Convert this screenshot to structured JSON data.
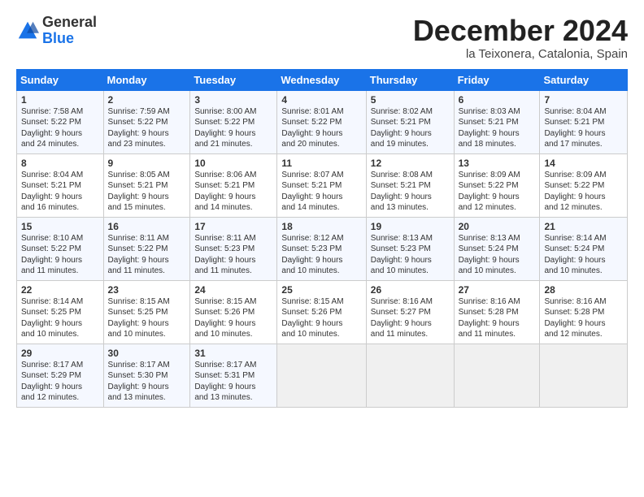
{
  "logo": {
    "general": "General",
    "blue": "Blue"
  },
  "title": "December 2024",
  "subtitle": "la Teixonera, Catalonia, Spain",
  "days_header": [
    "Sunday",
    "Monday",
    "Tuesday",
    "Wednesday",
    "Thursday",
    "Friday",
    "Saturday"
  ],
  "weeks": [
    [
      {
        "day": "1",
        "info": "Sunrise: 7:58 AM\nSunset: 5:22 PM\nDaylight: 9 hours\nand 24 minutes."
      },
      {
        "day": "2",
        "info": "Sunrise: 7:59 AM\nSunset: 5:22 PM\nDaylight: 9 hours\nand 23 minutes."
      },
      {
        "day": "3",
        "info": "Sunrise: 8:00 AM\nSunset: 5:22 PM\nDaylight: 9 hours\nand 21 minutes."
      },
      {
        "day": "4",
        "info": "Sunrise: 8:01 AM\nSunset: 5:22 PM\nDaylight: 9 hours\nand 20 minutes."
      },
      {
        "day": "5",
        "info": "Sunrise: 8:02 AM\nSunset: 5:21 PM\nDaylight: 9 hours\nand 19 minutes."
      },
      {
        "day": "6",
        "info": "Sunrise: 8:03 AM\nSunset: 5:21 PM\nDaylight: 9 hours\nand 18 minutes."
      },
      {
        "day": "7",
        "info": "Sunrise: 8:04 AM\nSunset: 5:21 PM\nDaylight: 9 hours\nand 17 minutes."
      }
    ],
    [
      {
        "day": "8",
        "info": "Sunrise: 8:04 AM\nSunset: 5:21 PM\nDaylight: 9 hours\nand 16 minutes."
      },
      {
        "day": "9",
        "info": "Sunrise: 8:05 AM\nSunset: 5:21 PM\nDaylight: 9 hours\nand 15 minutes."
      },
      {
        "day": "10",
        "info": "Sunrise: 8:06 AM\nSunset: 5:21 PM\nDaylight: 9 hours\nand 14 minutes."
      },
      {
        "day": "11",
        "info": "Sunrise: 8:07 AM\nSunset: 5:21 PM\nDaylight: 9 hours\nand 14 minutes."
      },
      {
        "day": "12",
        "info": "Sunrise: 8:08 AM\nSunset: 5:21 PM\nDaylight: 9 hours\nand 13 minutes."
      },
      {
        "day": "13",
        "info": "Sunrise: 8:09 AM\nSunset: 5:22 PM\nDaylight: 9 hours\nand 12 minutes."
      },
      {
        "day": "14",
        "info": "Sunrise: 8:09 AM\nSunset: 5:22 PM\nDaylight: 9 hours\nand 12 minutes."
      }
    ],
    [
      {
        "day": "15",
        "info": "Sunrise: 8:10 AM\nSunset: 5:22 PM\nDaylight: 9 hours\nand 11 minutes."
      },
      {
        "day": "16",
        "info": "Sunrise: 8:11 AM\nSunset: 5:22 PM\nDaylight: 9 hours\nand 11 minutes."
      },
      {
        "day": "17",
        "info": "Sunrise: 8:11 AM\nSunset: 5:23 PM\nDaylight: 9 hours\nand 11 minutes."
      },
      {
        "day": "18",
        "info": "Sunrise: 8:12 AM\nSunset: 5:23 PM\nDaylight: 9 hours\nand 10 minutes."
      },
      {
        "day": "19",
        "info": "Sunrise: 8:13 AM\nSunset: 5:23 PM\nDaylight: 9 hours\nand 10 minutes."
      },
      {
        "day": "20",
        "info": "Sunrise: 8:13 AM\nSunset: 5:24 PM\nDaylight: 9 hours\nand 10 minutes."
      },
      {
        "day": "21",
        "info": "Sunrise: 8:14 AM\nSunset: 5:24 PM\nDaylight: 9 hours\nand 10 minutes."
      }
    ],
    [
      {
        "day": "22",
        "info": "Sunrise: 8:14 AM\nSunset: 5:25 PM\nDaylight: 9 hours\nand 10 minutes."
      },
      {
        "day": "23",
        "info": "Sunrise: 8:15 AM\nSunset: 5:25 PM\nDaylight: 9 hours\nand 10 minutes."
      },
      {
        "day": "24",
        "info": "Sunrise: 8:15 AM\nSunset: 5:26 PM\nDaylight: 9 hours\nand 10 minutes."
      },
      {
        "day": "25",
        "info": "Sunrise: 8:15 AM\nSunset: 5:26 PM\nDaylight: 9 hours\nand 10 minutes."
      },
      {
        "day": "26",
        "info": "Sunrise: 8:16 AM\nSunset: 5:27 PM\nDaylight: 9 hours\nand 11 minutes."
      },
      {
        "day": "27",
        "info": "Sunrise: 8:16 AM\nSunset: 5:28 PM\nDaylight: 9 hours\nand 11 minutes."
      },
      {
        "day": "28",
        "info": "Sunrise: 8:16 AM\nSunset: 5:28 PM\nDaylight: 9 hours\nand 12 minutes."
      }
    ],
    [
      {
        "day": "29",
        "info": "Sunrise: 8:17 AM\nSunset: 5:29 PM\nDaylight: 9 hours\nand 12 minutes."
      },
      {
        "day": "30",
        "info": "Sunrise: 8:17 AM\nSunset: 5:30 PM\nDaylight: 9 hours\nand 13 minutes."
      },
      {
        "day": "31",
        "info": "Sunrise: 8:17 AM\nSunset: 5:31 PM\nDaylight: 9 hours\nand 13 minutes."
      },
      null,
      null,
      null,
      null
    ]
  ]
}
